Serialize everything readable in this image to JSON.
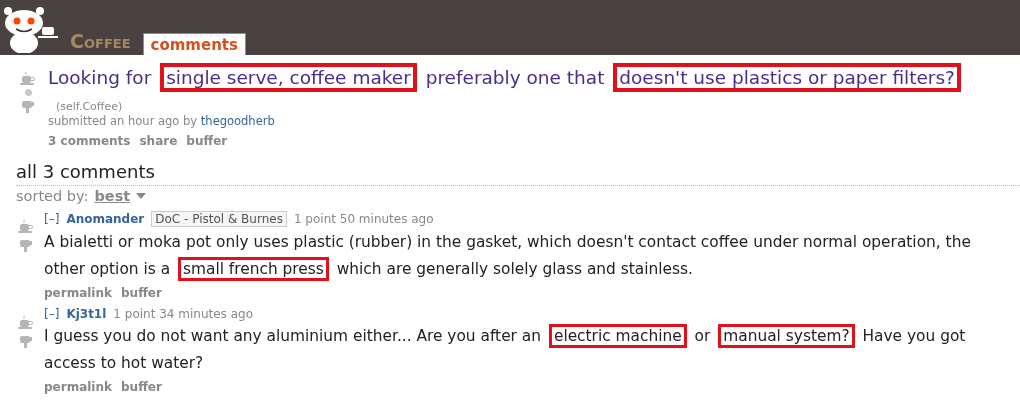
{
  "header": {
    "subreddit": "Coffee",
    "tabs": [
      {
        "label": "comments",
        "selected": true
      }
    ]
  },
  "post": {
    "title": [
      {
        "text": "Looking for ",
        "highlighted": false
      },
      {
        "text": "single serve, coffee maker",
        "highlighted": true
      },
      {
        "text": " preferably one that ",
        "highlighted": false
      },
      {
        "text": "doesn't use plastics or paper filters?",
        "highlighted": true
      }
    ],
    "domain": "(self.Coffee)",
    "submitted": "submitted an hour ago by",
    "author": "thegoodherb",
    "actions": [
      "3 comments",
      "share",
      "buffer"
    ]
  },
  "comments_heading": "all 3 comments",
  "sort": {
    "label": "sorted by:",
    "value": "best"
  },
  "comments": [
    {
      "toggle": "[–]",
      "author": "Anomander",
      "flair": "DoC - Pistol & Burnes",
      "meta": "1 point 50 minutes ago",
      "body": [
        {
          "text": "A bialetti or moka pot only uses plastic (rubber) in the gasket, which doesn't contact coffee under normal operation, the other option is a ",
          "highlighted": false
        },
        {
          "text": "small french press",
          "highlighted": true
        },
        {
          "text": " which are generally solely glass and stainless.",
          "highlighted": false
        }
      ],
      "actions": [
        "permalink",
        "buffer"
      ]
    },
    {
      "toggle": "[–]",
      "author": "Kj3t1l",
      "meta": "1 point 34 minutes ago",
      "body": [
        {
          "text": "I guess you do not want any aluminium either... Are you after an ",
          "highlighted": false
        },
        {
          "text": "electric machine",
          "highlighted": true
        },
        {
          "text": " or ",
          "highlighted": false
        },
        {
          "text": "manual system?",
          "highlighted": true
        },
        {
          "text": " Have you got access to hot water?",
          "highlighted": false
        }
      ],
      "actions": [
        "permalink",
        "buffer"
      ]
    }
  ]
}
